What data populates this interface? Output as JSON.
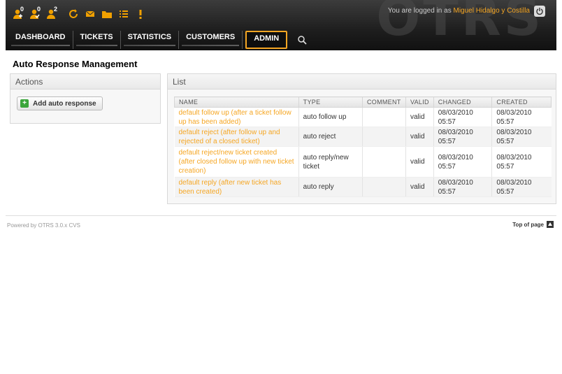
{
  "header": {
    "toolbar": [
      {
        "name": "locked-tickets-new-icon",
        "count": "0"
      },
      {
        "name": "locked-tickets-icon",
        "count": "0"
      },
      {
        "name": "my-tickets-icon",
        "count": "2"
      },
      {
        "name": "refresh-icon",
        "count": ""
      },
      {
        "name": "mail-icon",
        "count": ""
      },
      {
        "name": "folder-icon",
        "count": ""
      },
      {
        "name": "list-icon",
        "count": ""
      },
      {
        "name": "alert-icon",
        "count": ""
      }
    ],
    "login_prefix": "You are logged in as",
    "user_name": "Miguel Hidalgo y Costilla",
    "logo_text": "OTRS"
  },
  "nav": {
    "dashboard": "DASHBOARD",
    "tickets": "TICKETS",
    "statistics": "STATISTICS",
    "customers": "CUSTOMERS",
    "admin": "ADMIN"
  },
  "page": {
    "title": "Auto Response Management"
  },
  "actions": {
    "title": "Actions",
    "add_button": "Add auto response"
  },
  "list": {
    "title": "List",
    "columns": [
      "NAME",
      "TYPE",
      "COMMENT",
      "VALID",
      "CHANGED",
      "CREATED"
    ],
    "rows": [
      {
        "name": "default follow up (after a ticket follow up has been added)",
        "type": "auto follow up",
        "comment": "",
        "valid": "valid",
        "changed": "08/03/2010 05:57",
        "created": "08/03/2010 05:57"
      },
      {
        "name": "default reject (after follow up and rejected of a closed ticket)",
        "type": "auto reject",
        "comment": "",
        "valid": "valid",
        "changed": "08/03/2010 05:57",
        "created": "08/03/2010 05:57"
      },
      {
        "name": "default reject/new ticket created (after closed follow up with new ticket creation)",
        "type": "auto reply/new ticket",
        "comment": "",
        "valid": "valid",
        "changed": "08/03/2010 05:57",
        "created": "08/03/2010 05:57"
      },
      {
        "name": "default reply (after new ticket has been created)",
        "type": "auto reply",
        "comment": "",
        "valid": "valid",
        "changed": "08/03/2010 05:57",
        "created": "08/03/2010 05:57"
      }
    ]
  },
  "footer": {
    "powered": "Powered by OTRS 3.0.x CVS",
    "top_of_page": "Top of page"
  },
  "colors": {
    "accent": "#f5a623",
    "header_bg": "#1e1e1e",
    "add_green": "#3aa53a"
  }
}
